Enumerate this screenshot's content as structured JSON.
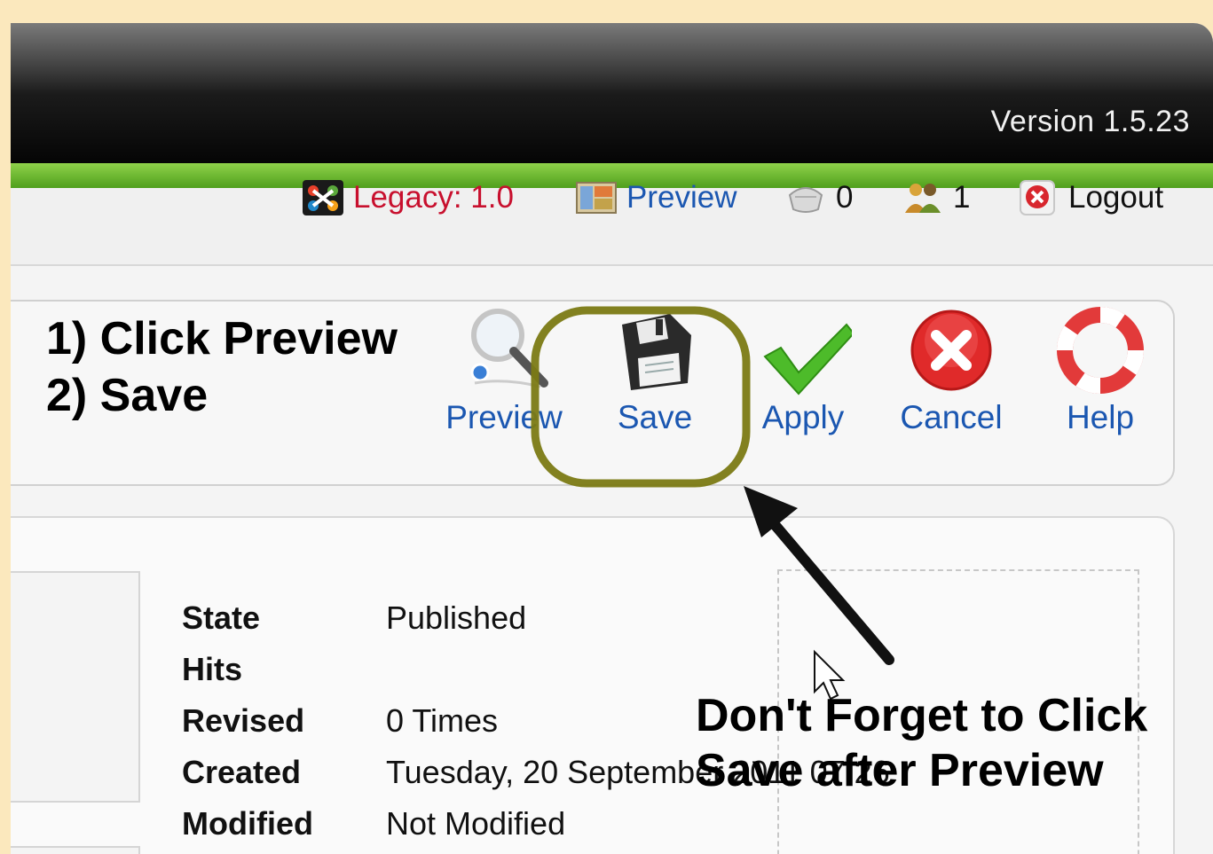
{
  "header": {
    "version": "Version 1.5.23"
  },
  "status_bar": {
    "legacy": "Legacy: 1.0",
    "preview": "Preview",
    "messages_count": "0",
    "users_count": "1",
    "logout": "Logout"
  },
  "instructions": {
    "line1": "1) Click Preview",
    "line2": "2) Save"
  },
  "toolbar": {
    "preview": "Preview",
    "save": "Save",
    "apply": "Apply",
    "cancel": "Cancel",
    "help": "Help"
  },
  "details": {
    "rows": [
      {
        "key": "State",
        "value": "Published"
      },
      {
        "key": "Hits",
        "value": ""
      },
      {
        "key": "Revised",
        "value": "0 Times"
      },
      {
        "key": "Created",
        "value": "Tuesday, 20 September 2011 07:26"
      },
      {
        "key": "Modified",
        "value": "Not Modified"
      }
    ]
  },
  "callout": {
    "line1": "Don't Forget to Click",
    "line2": "Save after Preview"
  },
  "colors": {
    "link": "#1b57b1",
    "legacy": "#c8102e",
    "highlight_ring": "#7b7a14",
    "green_bar": "#6ab42f"
  },
  "icons": [
    "joomla-icon",
    "preview-site-icon",
    "messages-icon",
    "users-icon",
    "logout-icon",
    "magnifier-icon",
    "floppy-disk-icon",
    "checkmark-icon",
    "cancel-icon",
    "lifebuoy-icon",
    "mouse-cursor-icon"
  ]
}
